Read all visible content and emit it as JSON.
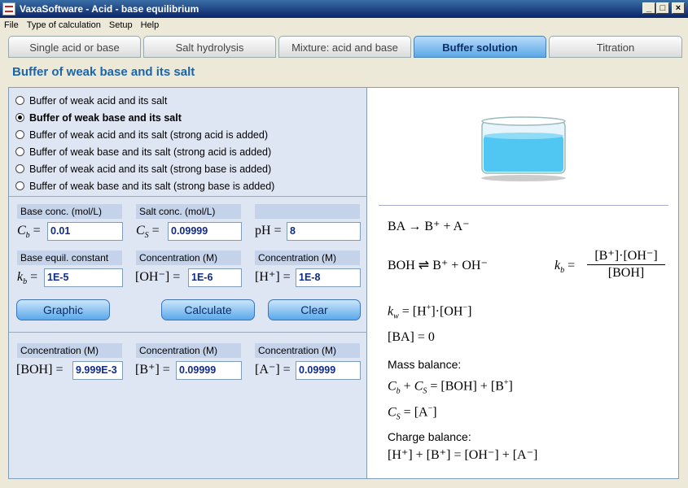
{
  "window": {
    "title": "VaxaSoftware - Acid - base equilibrium"
  },
  "menu": [
    "File",
    "Type of calculation",
    "Setup",
    "Help"
  ],
  "tabs": [
    {
      "label": "Single acid or base",
      "active": false
    },
    {
      "label": "Salt hydrolysis",
      "active": false
    },
    {
      "label": "Mixture: acid and base",
      "active": false
    },
    {
      "label": "Buffer solution",
      "active": true
    },
    {
      "label": "Titration",
      "active": false
    }
  ],
  "heading": "Buffer of weak base and its salt",
  "options": [
    {
      "label": "Buffer of weak acid and its salt",
      "selected": false
    },
    {
      "label": "Buffer of weak base and its salt",
      "selected": true
    },
    {
      "label": "Buffer of weak acid and its salt (strong acid is added)",
      "selected": false
    },
    {
      "label": "Buffer of weak base and its salt (strong acid is added)",
      "selected": false
    },
    {
      "label": "Buffer of weak acid and its salt (strong base is added)",
      "selected": false
    },
    {
      "label": "Buffer of weak base and its salt (strong base is added)",
      "selected": false
    }
  ],
  "fields": {
    "base_conc": {
      "label": "Base conc. (mol/L)",
      "symbol": "C_b =",
      "value": "0.01"
    },
    "salt_conc": {
      "label": "Salt conc. (mol/L)",
      "symbol": "C_S =",
      "value": "0.09999"
    },
    "ph": {
      "label": "",
      "symbol": "pH =",
      "value": "8"
    },
    "kb": {
      "label": "Base equil. constant",
      "symbol": "k_b =",
      "value": "1E-5"
    },
    "oh": {
      "label": "Concentration (M)",
      "symbol": "[OH⁻] =",
      "value": "1E-6"
    },
    "h": {
      "label": "Concentration (M)",
      "symbol": "[H⁺] =",
      "value": "1E-8"
    },
    "boh": {
      "label": "Concentration (M)",
      "symbol": "[BOH] =",
      "value": "9.999E-3"
    },
    "bplus": {
      "label": "Concentration (M)",
      "symbol": "[B⁺] =",
      "value": "0.09999"
    },
    "aminus": {
      "label": "Concentration (M)",
      "symbol": "[A⁻] =",
      "value": "0.09999"
    }
  },
  "buttons": {
    "graphic": "Graphic",
    "calculate": "Calculate",
    "clear": "Clear"
  },
  "equations": {
    "eq1": "BA  →  B⁺  +  A⁻",
    "eq2": "BOH  ⇌  B⁺  +  OH⁻",
    "kb_label": "k_b =",
    "kb_num": "[B⁺]·[OH⁻]",
    "kb_den": "[BOH]",
    "kw": "k_w = [H⁺]·[OH⁻]",
    "ba": "[BA]  = 0",
    "mass_title": "Mass balance:",
    "mass1": "C_b + C_S = [BOH] + [B⁺]",
    "mass2": "C_S = [A⁻]",
    "charge_title": "Charge balance:",
    "charge1": "[H⁺] + [B⁺] = [OH⁻] + [A⁻]"
  },
  "colors": {
    "accent": "#1c64a8",
    "input_text": "#102a8c",
    "tab_active": "#5aa8e8"
  }
}
